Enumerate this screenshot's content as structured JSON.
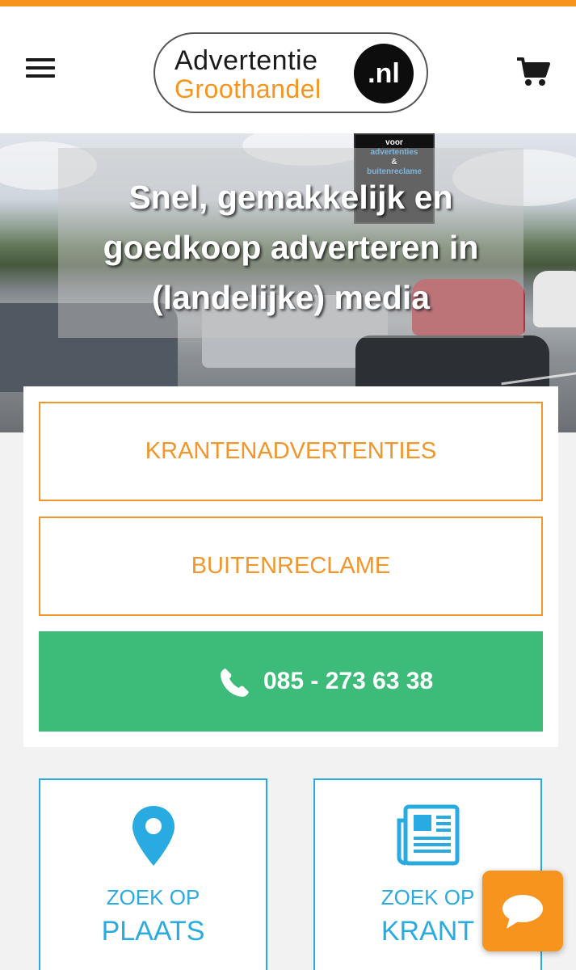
{
  "header": {
    "logo_line1": "Advertentie",
    "logo_line2": "Groothandel",
    "logo_badge": ".nl",
    "menu_icon": "hamburger-icon",
    "cart_icon": "shopping-cart-icon"
  },
  "hero": {
    "title": "Snel, gemakkelijk en goedkoop adverteren in (landelijke) media",
    "billboard_lines": [
      "voor",
      "advertenties",
      "&",
      "buitenreclame"
    ]
  },
  "actions": {
    "krantenadvertenties_label": "KRANTENADVERTENTIES",
    "buitenreclame_label": "BUITENRECLAME",
    "phone_number": "085 - 273 63 38",
    "phone_icon": "phone-icon"
  },
  "tiles": [
    {
      "small": "ZOEK OP",
      "big": "PLAATS",
      "icon": "map-pin-icon"
    },
    {
      "small": "ZOEK OP",
      "big": "KRANT",
      "icon": "newspaper-icon"
    }
  ],
  "chat": {
    "icon": "chat-bubble-icon"
  },
  "colors": {
    "accent_orange": "#f7941d",
    "button_outline_orange": "#f0962a",
    "phone_green": "#3dbb78",
    "tile_blue": "#29abe2"
  }
}
